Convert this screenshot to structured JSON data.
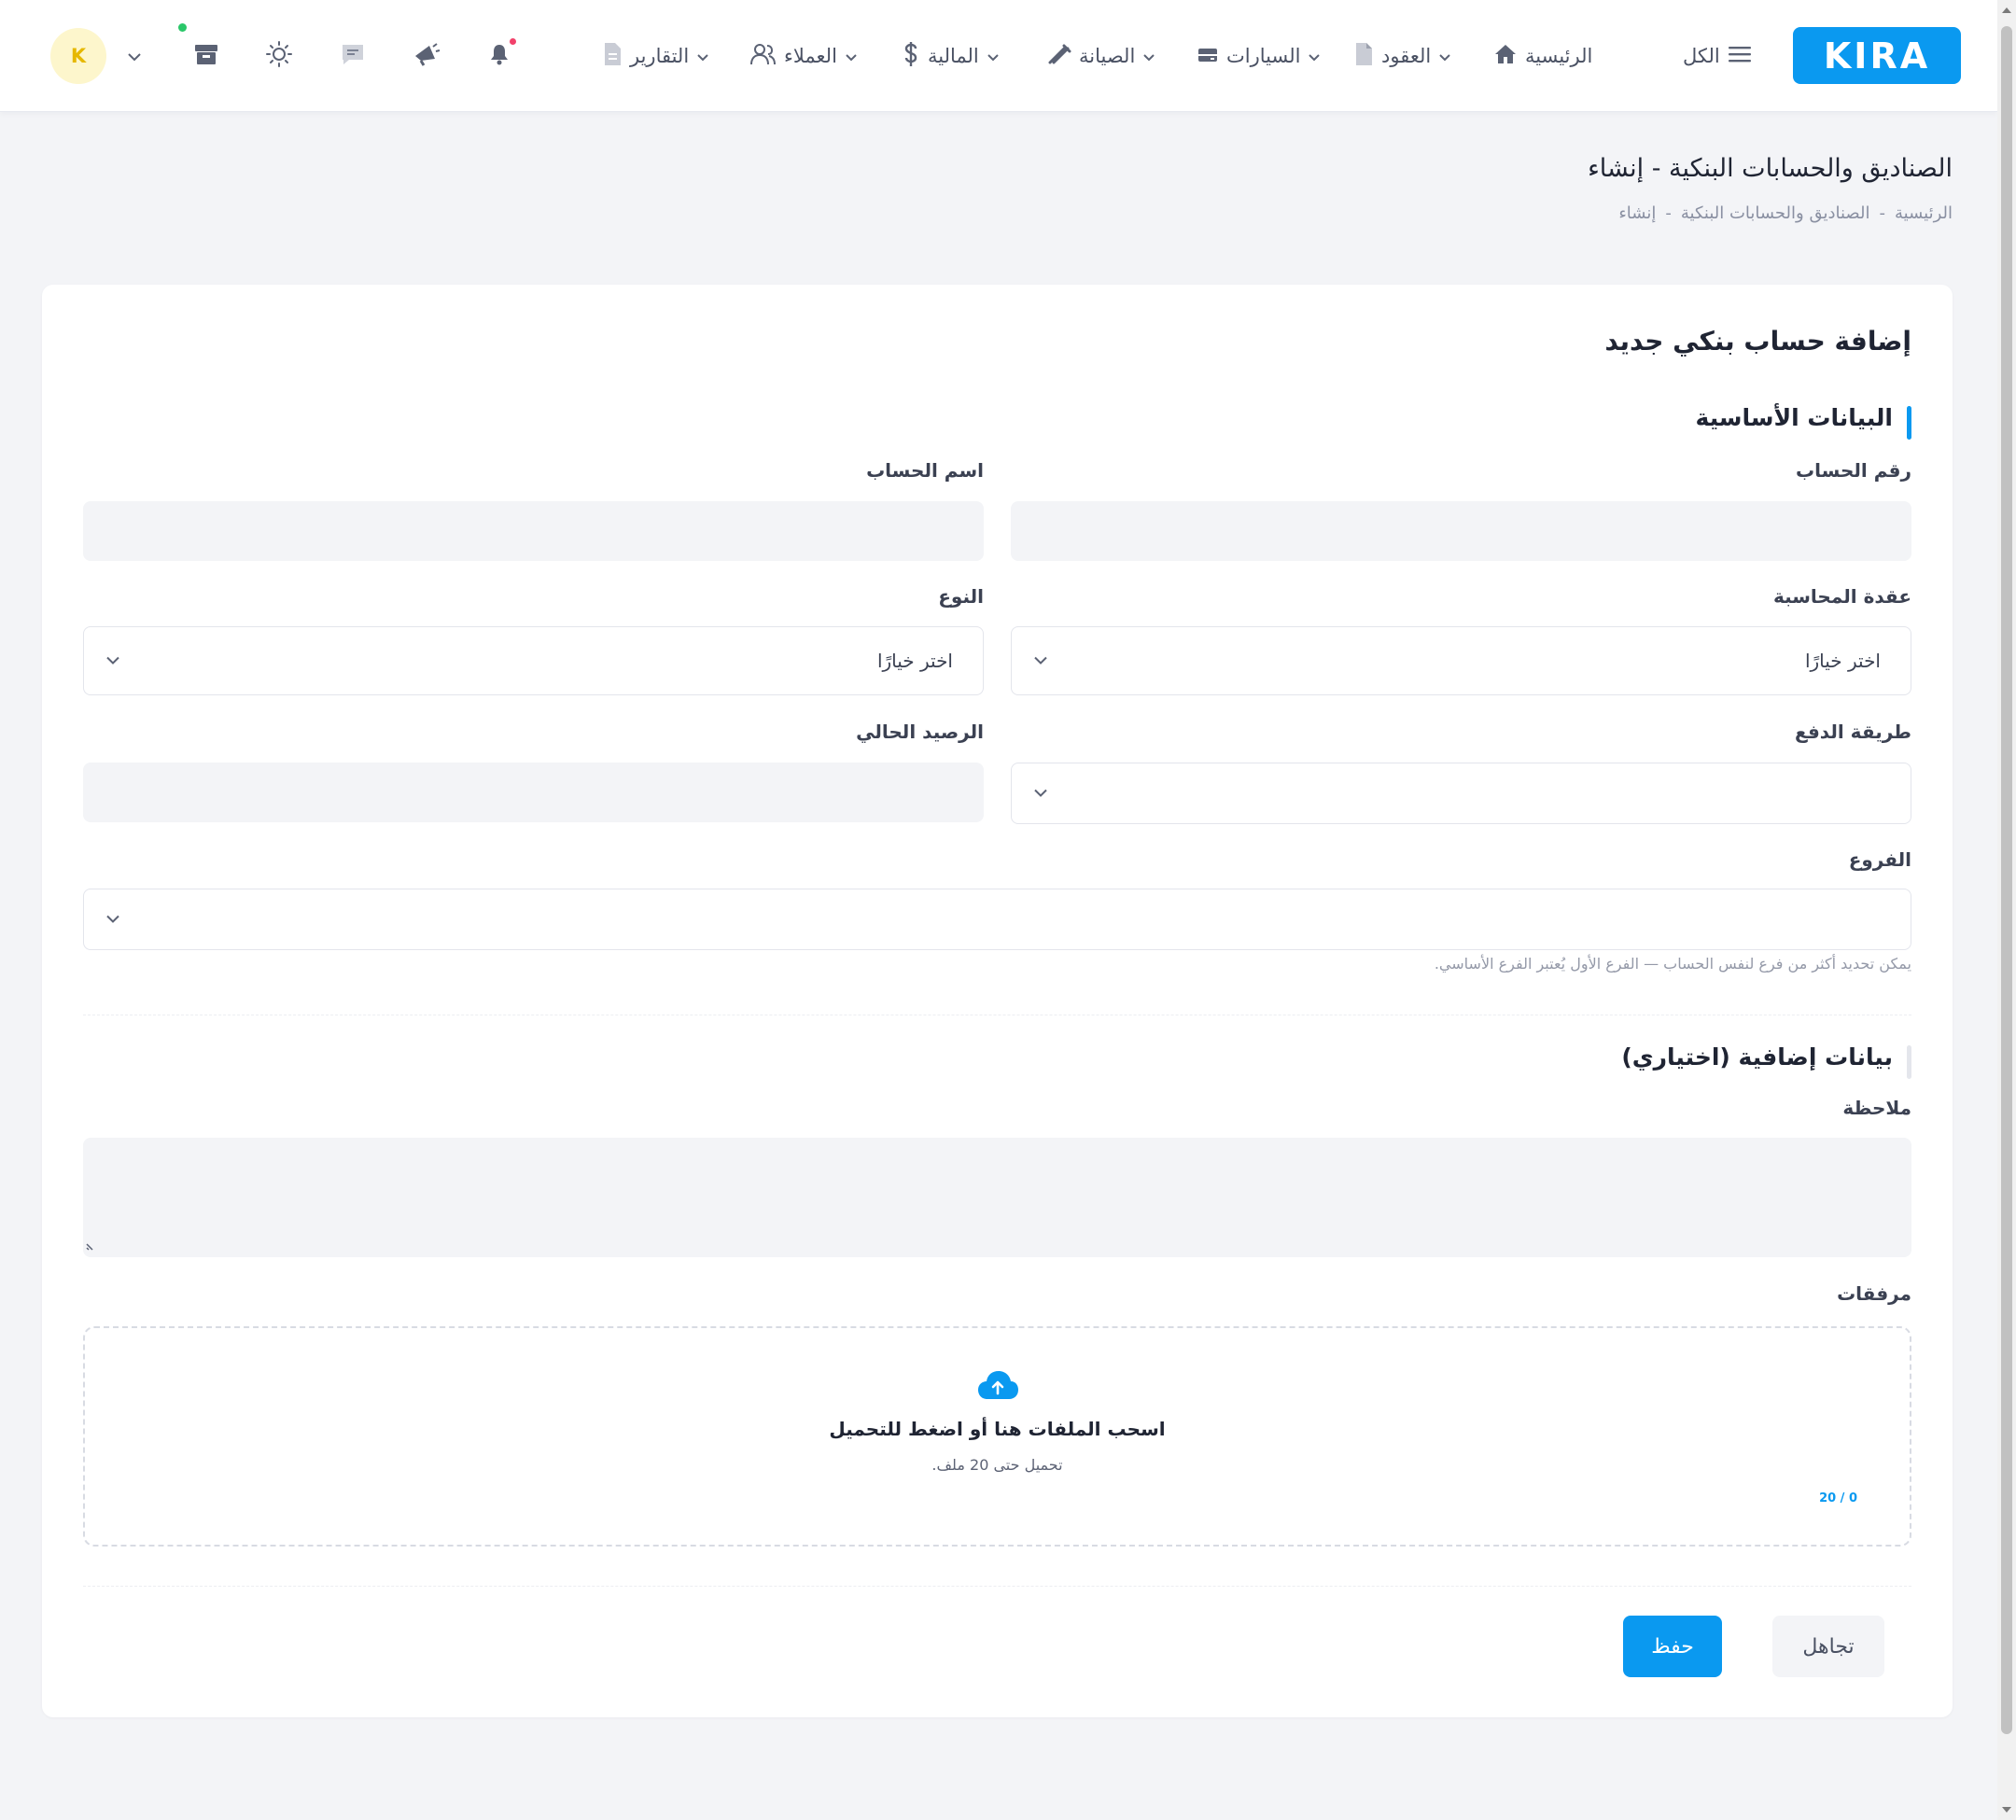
{
  "app": {
    "logo_text": "KIRA",
    "brand_color": "#0a99f0"
  },
  "nav": {
    "all_label": "الكل",
    "items": [
      {
        "label": "الرئيسية",
        "icon": "home-icon"
      },
      {
        "label": "العقود",
        "icon": "document-icon"
      },
      {
        "label": "السيارات",
        "icon": "car-icon"
      },
      {
        "label": "الصيانة",
        "icon": "wrench-icon"
      },
      {
        "label": "المالية",
        "icon": "dollar-icon"
      },
      {
        "label": "العملاء",
        "icon": "users-icon"
      },
      {
        "label": "التقارير",
        "icon": "report-icon"
      }
    ],
    "user_initial": "K"
  },
  "page": {
    "title": "الصناديق والحسابات البنكية - إنشاء",
    "breadcrumb": [
      "الرئيسية",
      "-",
      "الصناديق والحسابات البنكية",
      "-",
      "إنشاء"
    ]
  },
  "form": {
    "title": "إضافة حساب بنكي جديد",
    "basic_section": "البيانات الأساسية",
    "account_number_label": "رقم الحساب",
    "account_name_label": "اسم الحساب",
    "accounting_node_label": "عقدة المحاسبة",
    "accounting_node_value": "اختر خيارًا",
    "type_label": "النوع",
    "type_value": "اختر خيارًا",
    "payment_method_label": "طريقة الدفع",
    "current_balance_label": "الرصيد الحالي",
    "branches_label": "الفروع",
    "branches_hint": "يمكن تحديد أكثر من فرع لنفس الحساب — الفرع الأول يُعتبر الفرع الأساسي.",
    "extra_section": "بيانات إضافية (اختياري)",
    "note_label": "ملاحظة",
    "attachments_label": "مرفقات",
    "dropzone_title": "اسحب الملفات هنا أو اضغط للتحميل",
    "dropzone_sub": "تحميل حتى 20 ملف.",
    "dropzone_count": "20 / 0",
    "save_label": "حفظ",
    "cancel_label": "تجاهل"
  }
}
